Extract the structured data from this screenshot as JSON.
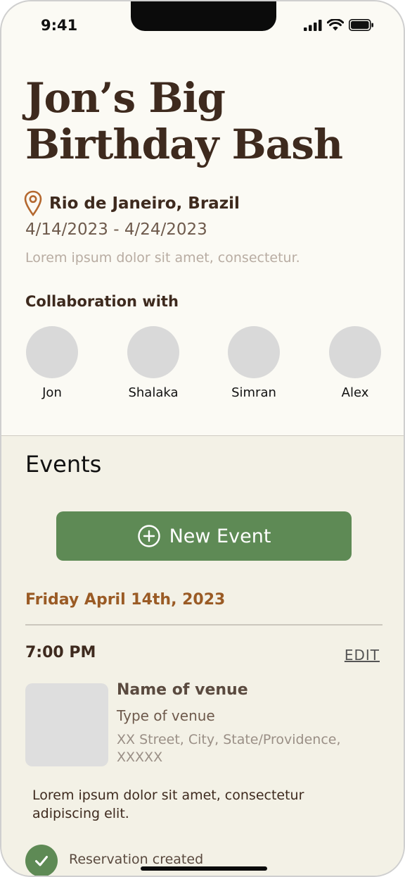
{
  "status_bar": {
    "time": "9:41"
  },
  "trip": {
    "title": "Jon’s Big Birthday Bash",
    "location": "Rio de Janeiro, Brazil",
    "dates": "4/14/2023 - 4/24/2023",
    "description": "Lorem ipsum dolor sit amet, consectetur."
  },
  "collaboration": {
    "title": "Collaboration with",
    "people": [
      "Jon",
      "Shalaka",
      "Simran",
      "Alex"
    ]
  },
  "events": {
    "title": "Events",
    "new_event_label": "New Event",
    "day_title": "Friday April 14th, 2023",
    "event": {
      "time": "7:00 PM",
      "edit_label": "EDIT",
      "venue_name": "Name of venue",
      "venue_type": "Type of venue",
      "venue_address": "XX Street, City, State/Providence, XXXXX",
      "description": "Lorem ipsum dolor sit amet, consectetur adipiscing elit.",
      "status": "Reservation created"
    }
  },
  "colors": {
    "title_brown": "#3e2a1e",
    "accent_orange": "#9a5b25",
    "button_green": "#5e8a55",
    "events_background": "#f3f1e6"
  },
  "icons": [
    "location-pin-icon",
    "signal-icon",
    "wifi-icon",
    "battery-icon",
    "plus-circle-icon",
    "check-icon"
  ]
}
